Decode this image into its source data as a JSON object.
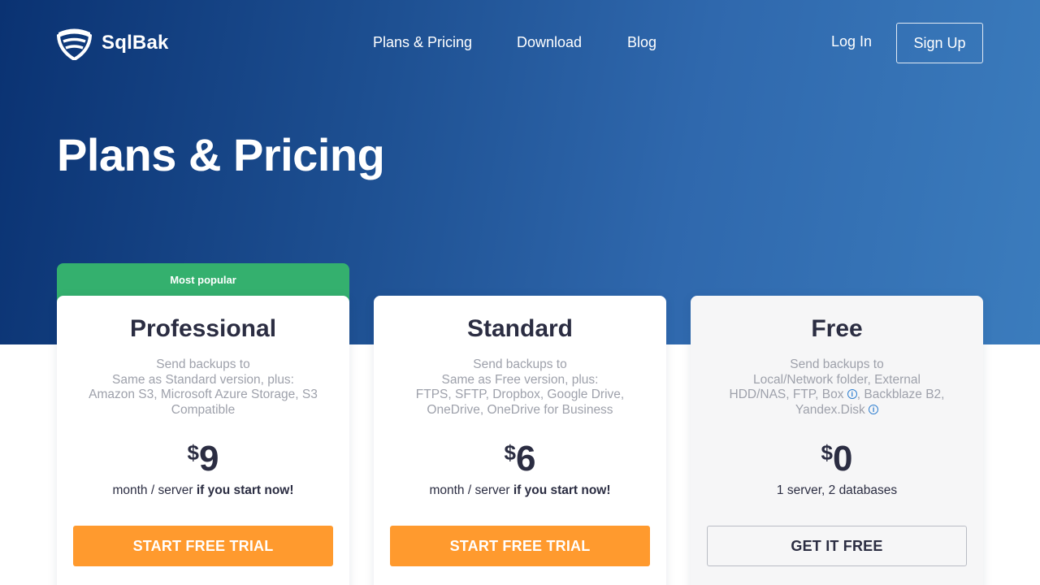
{
  "brand": {
    "name": "SqlBak"
  },
  "nav": {
    "plans": "Plans & Pricing",
    "download": "Download",
    "blog": "Blog",
    "login": "Log In",
    "signup": "Sign Up"
  },
  "page_title": "Plans & Pricing",
  "badge": "Most popular",
  "plans": [
    {
      "name": "Professional",
      "desc_label": "Send backups to",
      "desc_lines": [
        "Same as Standard version, plus:",
        "Amazon S3, Microsoft Azure Storage, S3",
        "Compatible"
      ],
      "currency": "$",
      "price": "9",
      "note_prefix": "month / server",
      "note_bold": "if you start now!",
      "cta": "START FREE TRIAL"
    },
    {
      "name": "Standard",
      "desc_label": "Send backups to",
      "desc_lines": [
        "Same as Free version, plus:",
        "FTPS, SFTP, Dropbox, Google Drive,",
        "OneDrive, OneDrive for Business"
      ],
      "currency": "$",
      "price": "6",
      "note_prefix": "month / server",
      "note_bold": "if you start now!",
      "cta": "START FREE TRIAL"
    },
    {
      "name": "Free",
      "desc_label": "Send backups to",
      "desc_line1": "Local/Network folder, External",
      "desc_line2_a": "HDD/NAS, FTP, Box",
      "desc_line2_b": ", Backblaze B2,",
      "desc_line3": "Yandex.Disk",
      "currency": "$",
      "price": "0",
      "note": "1 server, 2 databases",
      "cta": "GET IT FREE"
    }
  ],
  "colors": {
    "hero_start": "#0a3272",
    "hero_end": "#3b7cbd",
    "badge_green": "#34b06e",
    "cta_orange": "#ff9a2e",
    "text_dark": "#2b2d42",
    "text_muted": "#9ea1ab",
    "info_blue": "#2f7fd0"
  },
  "icons": {
    "logo": "shield-logo-icon",
    "info": "info-icon"
  }
}
